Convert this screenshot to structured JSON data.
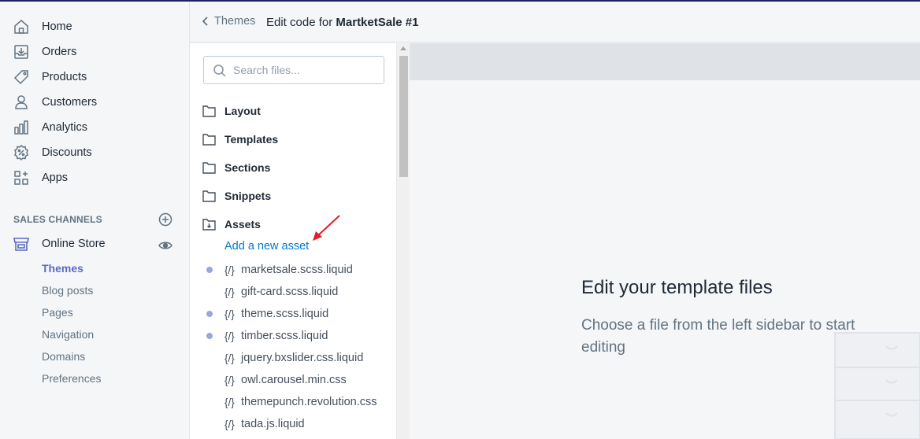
{
  "nav": {
    "items": [
      {
        "label": "Home",
        "icon": "home-icon"
      },
      {
        "label": "Orders",
        "icon": "orders-icon"
      },
      {
        "label": "Products",
        "icon": "tag-icon"
      },
      {
        "label": "Customers",
        "icon": "person-icon"
      },
      {
        "label": "Analytics",
        "icon": "bar-chart-icon"
      },
      {
        "label": "Discounts",
        "icon": "discount-icon"
      },
      {
        "label": "Apps",
        "icon": "apps-icon"
      }
    ],
    "sales_channels_label": "SALES CHANNELS",
    "online_store_label": "Online Store",
    "sub_items": [
      {
        "label": "Themes",
        "active": true
      },
      {
        "label": "Blog posts"
      },
      {
        "label": "Pages"
      },
      {
        "label": "Navigation"
      },
      {
        "label": "Domains"
      },
      {
        "label": "Preferences"
      }
    ]
  },
  "header": {
    "back_label": "Themes",
    "title_prefix": "Edit code for",
    "theme_name": "MartketSale #1"
  },
  "files": {
    "search_placeholder": "Search files...",
    "folders": [
      "Layout",
      "Templates",
      "Sections",
      "Snippets",
      "Assets"
    ],
    "add_asset_label": "Add a new asset",
    "code_glyph": "{/}",
    "assets": [
      {
        "name": "marketsale.scss.liquid",
        "modified": true
      },
      {
        "name": "gift-card.scss.liquid",
        "modified": false
      },
      {
        "name": "theme.scss.liquid",
        "modified": true
      },
      {
        "name": "timber.scss.liquid",
        "modified": true
      },
      {
        "name": "jquery.bxslider.css.liquid",
        "modified": false
      },
      {
        "name": "owl.carousel.min.css",
        "modified": false
      },
      {
        "name": "themepunch.revolution.css",
        "modified": false
      },
      {
        "name": "tada.js.liquid",
        "modified": false
      }
    ]
  },
  "editor": {
    "empty_title": "Edit your template files",
    "empty_description": "Choose a file from the left sidebar to start editing"
  },
  "colors": {
    "accent": "#5c6ac4",
    "link": "#007ace",
    "annotation_arrow": "#e01e2b"
  }
}
